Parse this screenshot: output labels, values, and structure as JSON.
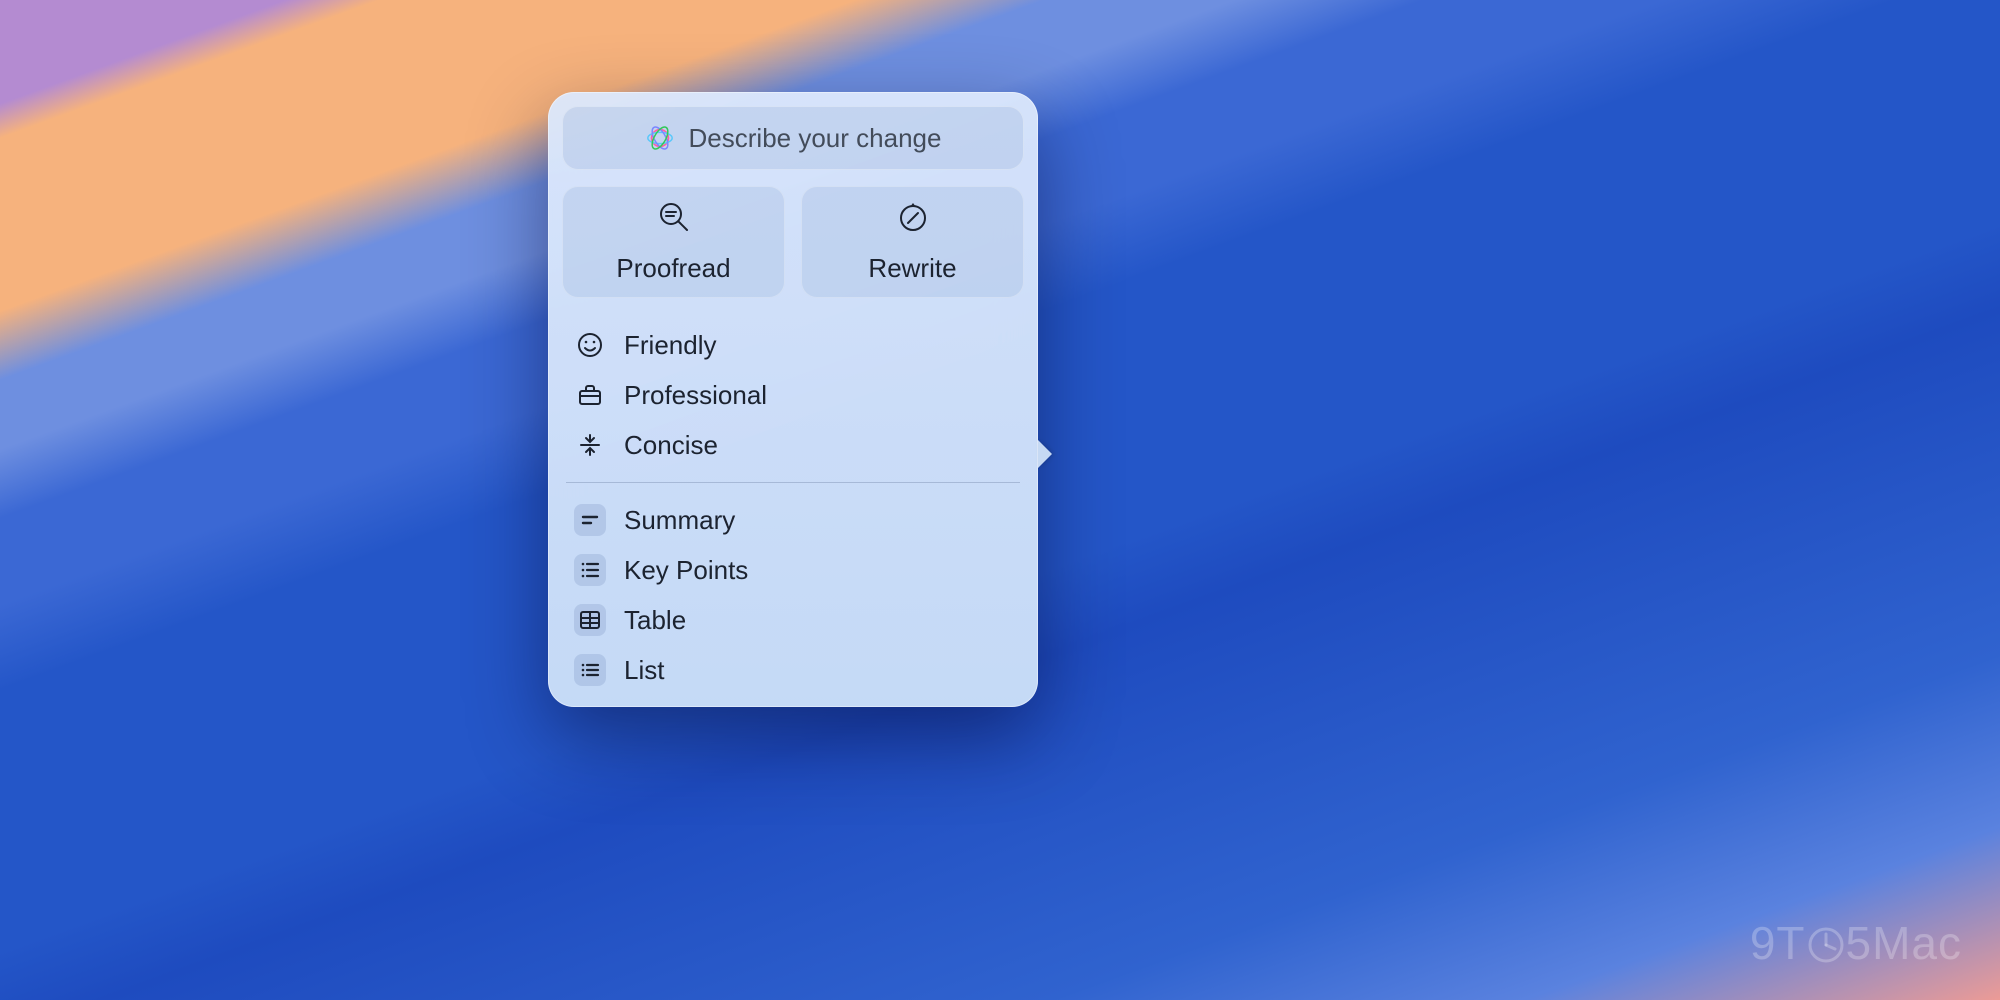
{
  "input": {
    "placeholder": "Describe your change"
  },
  "primary": {
    "proofread": "Proofread",
    "rewrite": "Rewrite"
  },
  "tones": [
    {
      "id": "friendly",
      "label": "Friendly"
    },
    {
      "id": "professional",
      "label": "Professional"
    },
    {
      "id": "concise",
      "label": "Concise"
    }
  ],
  "formats": [
    {
      "id": "summary",
      "label": "Summary"
    },
    {
      "id": "keypoints",
      "label": "Key Points"
    },
    {
      "id": "table",
      "label": "Table"
    },
    {
      "id": "list",
      "label": "List"
    }
  ],
  "watermark": "9T😄5Mac"
}
